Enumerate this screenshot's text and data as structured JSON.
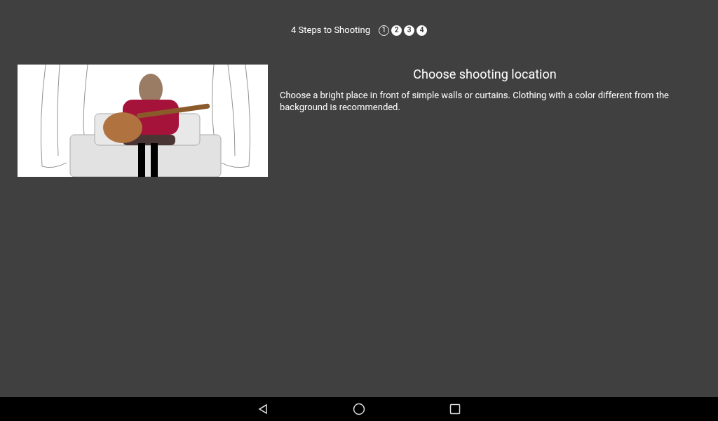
{
  "header": {
    "title": "4 Steps to Shooting",
    "steps": [
      {
        "label": "1",
        "selected": true
      },
      {
        "label": "2",
        "selected": false
      },
      {
        "label": "3",
        "selected": false
      },
      {
        "label": "4",
        "selected": false
      }
    ]
  },
  "step": {
    "heading": "Choose shooting location",
    "description": "Choose a bright place in front of simple walls or curtains. Clothing with a color different from the background is recommended."
  }
}
